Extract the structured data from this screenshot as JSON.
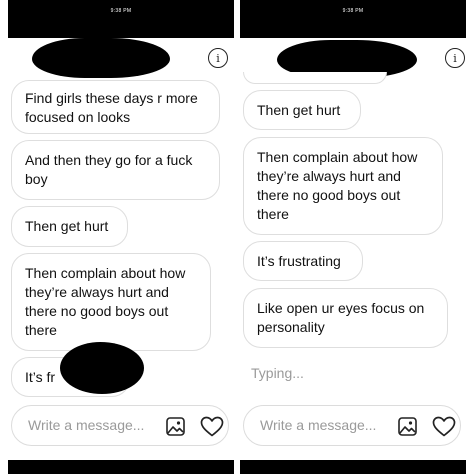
{
  "status_bar": {
    "time": "9:38 PM"
  },
  "left_screen": {
    "messages": [
      "Find girls these days r more focused on looks",
      "And then they go for a fuck boy",
      "Then get hurt",
      "Then complain about how they’re always hurt and there no good boys out there",
      "It’s fr"
    ],
    "composer": {
      "placeholder": "Write a message..."
    }
  },
  "right_screen": {
    "messages": [
      "Then get hurt",
      "Then complain about how they’re always hurt and there no good boys out there",
      "It’s frustrating",
      "Like open ur eyes focus on personality"
    ],
    "typing_indicator": "Typing...",
    "composer": {
      "placeholder": "Write a message..."
    }
  },
  "colors": {
    "accent": "#000000",
    "bubble_border": "#dedede",
    "placeholder": "#9a9a9a"
  },
  "icons": {
    "info": "info-icon",
    "gallery": "gallery-icon",
    "heart": "heart-icon"
  }
}
